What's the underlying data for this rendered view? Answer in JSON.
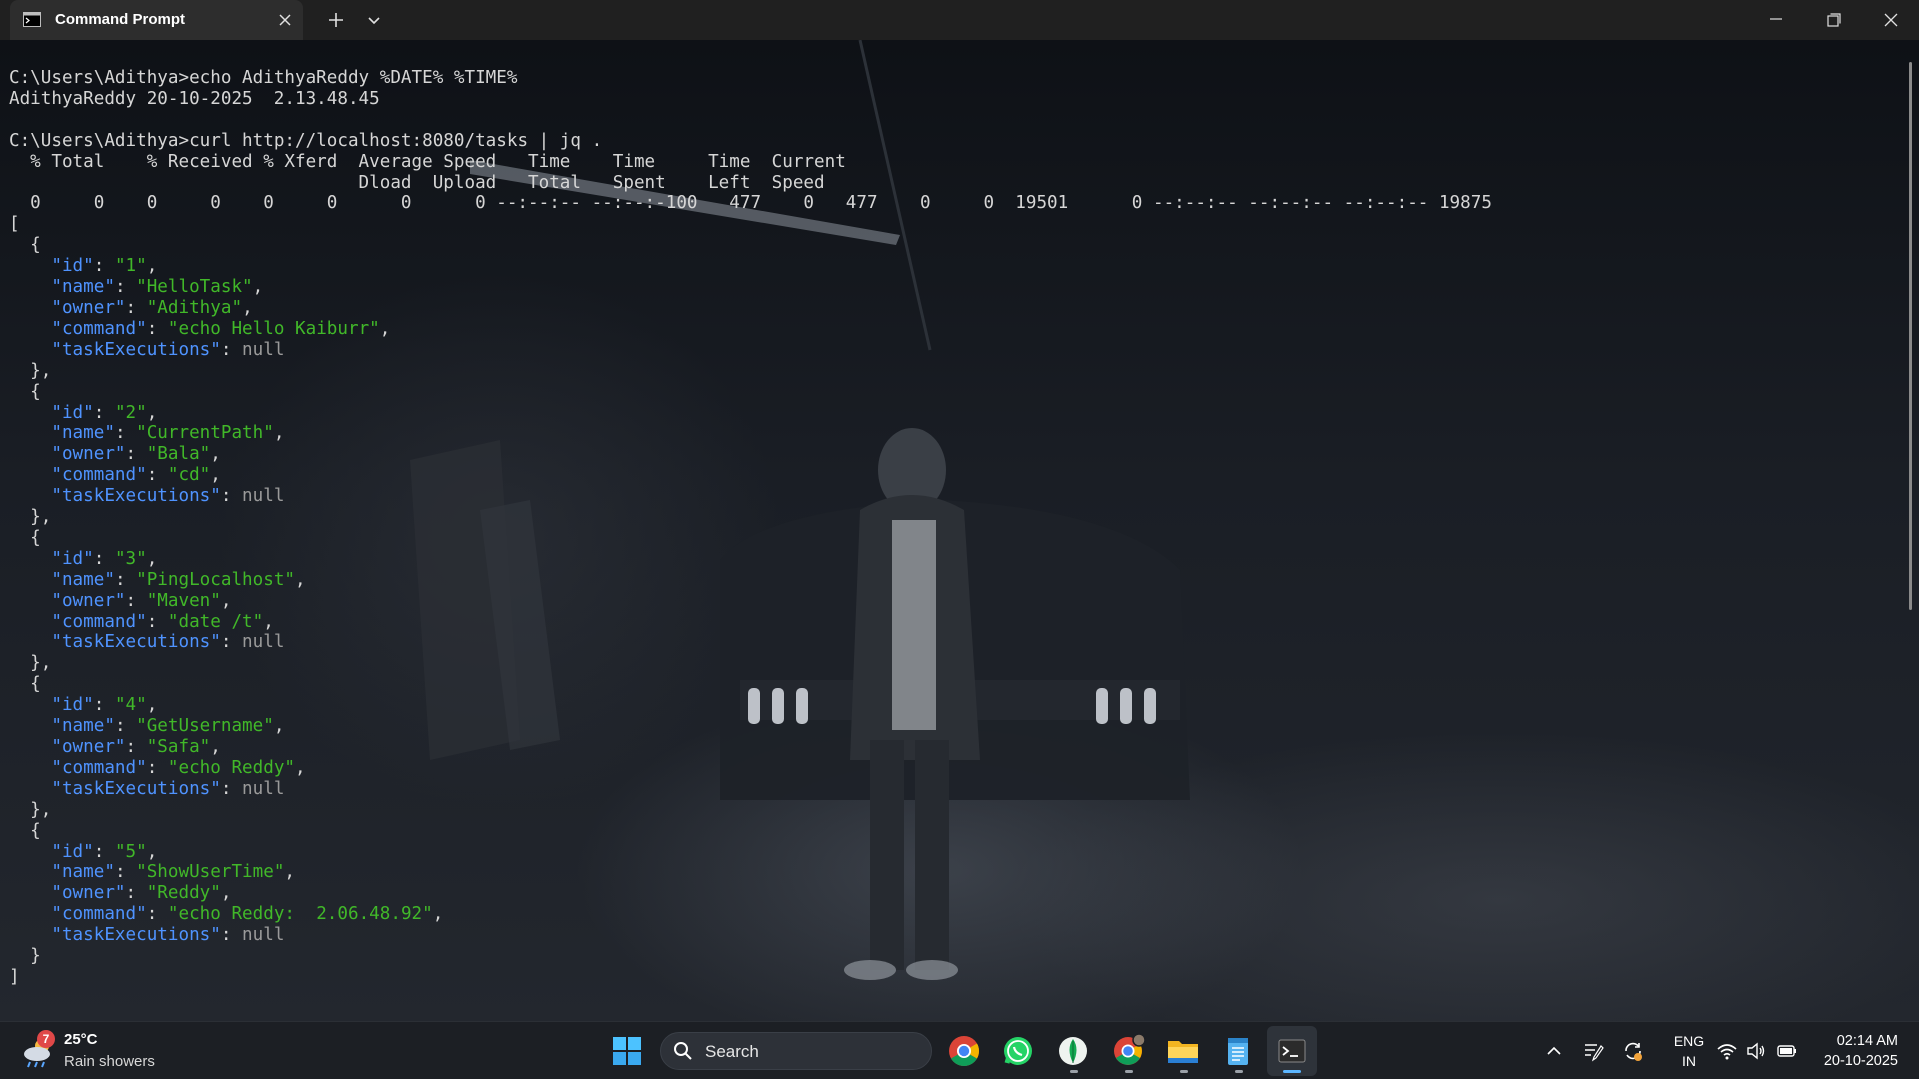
{
  "window": {
    "tab_title": "Command Prompt"
  },
  "terminal": {
    "cmd1_prompt": "C:\\Users\\Adithya>",
    "cmd1": "echo AdithyaReddy %DATE% %TIME%",
    "out1": "AdithyaReddy 20-10-2025  2.13.48.45",
    "cmd2_prompt": "C:\\Users\\Adithya>",
    "cmd2": "curl http://localhost:8080/tasks | jq .",
    "curl_header1": "  % Total    % Received % Xferd  Average Speed   Time    Time     Time  Current",
    "curl_header2": "                                 Dload  Upload   Total   Spent    Left  Speed",
    "curl_progress": "  0     0    0     0    0     0      0      0 --:--:-- --:--:-100   477    0   477    0     0  19501      0 --:--:-- --:--:-- --:--:-- 19875",
    "json_open": "[",
    "json_close": "]",
    "tasks": [
      {
        "id": "\"1\"",
        "name": "\"HelloTask\"",
        "owner": "\"Adithya\"",
        "command": "\"echo Hello Kaiburr\"",
        "taskExecutions": "null"
      },
      {
        "id": "\"2\"",
        "name": "\"CurrentPath\"",
        "owner": "\"Bala\"",
        "command": "\"cd\"",
        "taskExecutions": "null"
      },
      {
        "id": "\"3\"",
        "name": "\"PingLocalhost\"",
        "owner": "\"Maven\"",
        "command": "\"date /t\"",
        "taskExecutions": "null"
      },
      {
        "id": "\"4\"",
        "name": "\"GetUsername\"",
        "owner": "\"Safa\"",
        "command": "\"echo Reddy\"",
        "taskExecutions": "null"
      },
      {
        "id": "\"5\"",
        "name": "\"ShowUserTime\"",
        "owner": "\"Reddy\"",
        "command": "\"echo Reddy:  2.06.48.92\"",
        "taskExecutions": "null"
      }
    ],
    "keys": {
      "id": "\"id\"",
      "name": "\"name\"",
      "owner": "\"owner\"",
      "command": "\"command\"",
      "taskExecutions": "\"taskExecutions\""
    }
  },
  "taskbar": {
    "weather": {
      "badge": "7",
      "temp": "25°C",
      "desc": "Rain showers"
    },
    "search_placeholder": "Search",
    "apps": [
      "start-icon",
      "chrome-icon",
      "whatsapp-icon",
      "mongodb-compass-icon",
      "chrome-profile-icon",
      "file-explorer-icon",
      "notepad-icon",
      "terminal-icon"
    ],
    "tray": {
      "lang_top": "ENG",
      "lang_bottom": "IN",
      "time": "02:14 AM",
      "date": "20-10-2025"
    }
  },
  "colors": {
    "json_key": "#4f93ff",
    "json_string": "#41b829",
    "json_null": "#9a9a9a",
    "terminal_text": "#d6d6d6"
  }
}
